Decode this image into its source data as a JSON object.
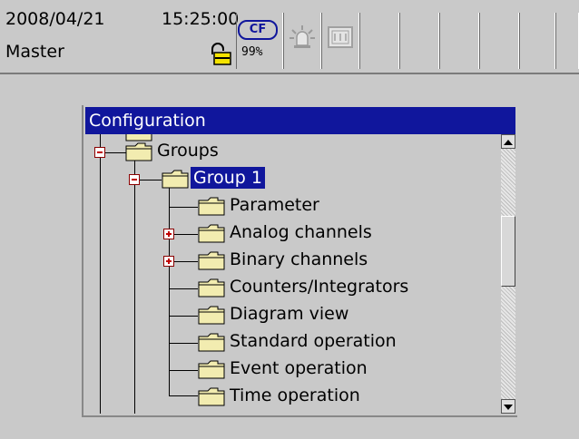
{
  "status": {
    "date": "2008/04/21",
    "time": "15:25:00",
    "user": "Master",
    "storage_label": "CF",
    "storage_percent": "99%",
    "icons": [
      "lock-icon",
      "alarm-icon",
      "status-icon"
    ]
  },
  "dialog": {
    "title": "Configuration",
    "tree": {
      "groups": "Groups",
      "group1": "Group 1",
      "items": [
        "Parameter",
        "Analog channels",
        "Binary channels",
        "Counters/Integrators",
        "Diagram view",
        "Standard operation",
        "Event operation",
        "Time operation"
      ]
    }
  },
  "colors": {
    "title_bar": "#10169c",
    "background": "#c9c9c9",
    "folder": "#f2ecb0"
  }
}
